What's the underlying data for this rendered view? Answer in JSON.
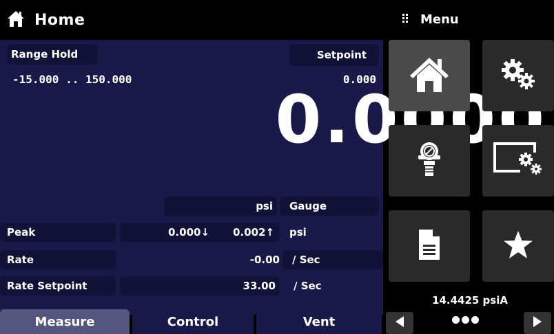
{
  "header": {
    "title": "Home",
    "menu_title": "Menu"
  },
  "panel": {
    "range_hold_label": "Range Hold",
    "range_value": "-15.000 .. 150.000",
    "setpoint_label": "Setpoint",
    "setpoint_value": "0.000",
    "reading": "0.0000",
    "unit": "psi",
    "mode": "Gauge",
    "peak_label": "Peak",
    "peak_min": "0.000↓",
    "peak_max": "0.002↑",
    "peak_unit": "psi",
    "rate_label": "Rate",
    "rate_value": "-0.00",
    "rate_unit": "/ Sec",
    "rate_setpoint_label": "Rate Setpoint",
    "rate_setpoint_value": "33.00",
    "rate_setpoint_unit": "/ Sec"
  },
  "tabs": [
    {
      "label": "Measure",
      "active": true
    },
    {
      "label": "Control",
      "active": false
    },
    {
      "label": "Vent",
      "active": false
    }
  ],
  "menu": {
    "tiles": [
      {
        "icon": "home-icon",
        "selected": true
      },
      {
        "icon": "settings-gears-icon",
        "selected": false
      },
      {
        "icon": "sensor-icon",
        "selected": false
      },
      {
        "icon": "display-settings-icon",
        "selected": false
      },
      {
        "icon": "document-icon",
        "selected": false
      },
      {
        "icon": "star-icon",
        "selected": false
      }
    ],
    "barometer": "14.4425 psiA"
  },
  "colors": {
    "panel": "#1a1a4a",
    "tile": "#121238",
    "active_tab": "#55557d",
    "menu_tile": "#2a2a2a"
  }
}
